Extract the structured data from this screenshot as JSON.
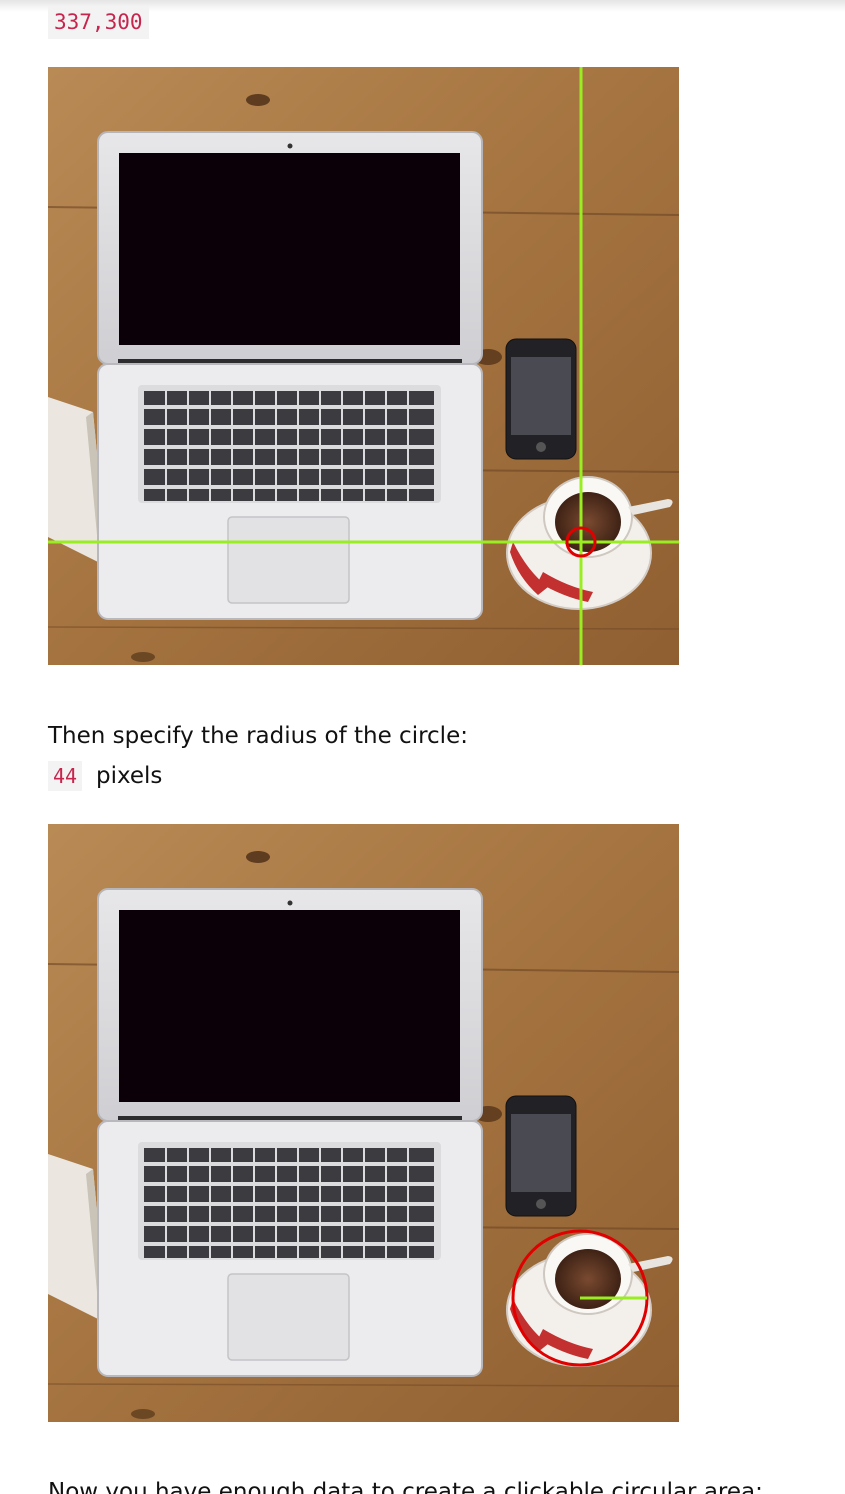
{
  "center_coords": "337,300",
  "para_radius": "Then specify the radius of the circle:",
  "radius_value": "44",
  "radius_unit": "pixels",
  "para_final": "Now you have enough data to create a clickable circular area:",
  "colors": {
    "code_text": "#c7254e",
    "code_bg": "#f3f3f3",
    "guide_line": "#99ee22",
    "circle_marker": "#e00000",
    "wood": "#a87844"
  },
  "figures": [
    {
      "name": "laptop-coffee-photo-crosshair",
      "overlay": "crosshair-with-center-marker"
    },
    {
      "name": "laptop-coffee-photo-circle",
      "overlay": "circle-with-radius-line"
    }
  ]
}
